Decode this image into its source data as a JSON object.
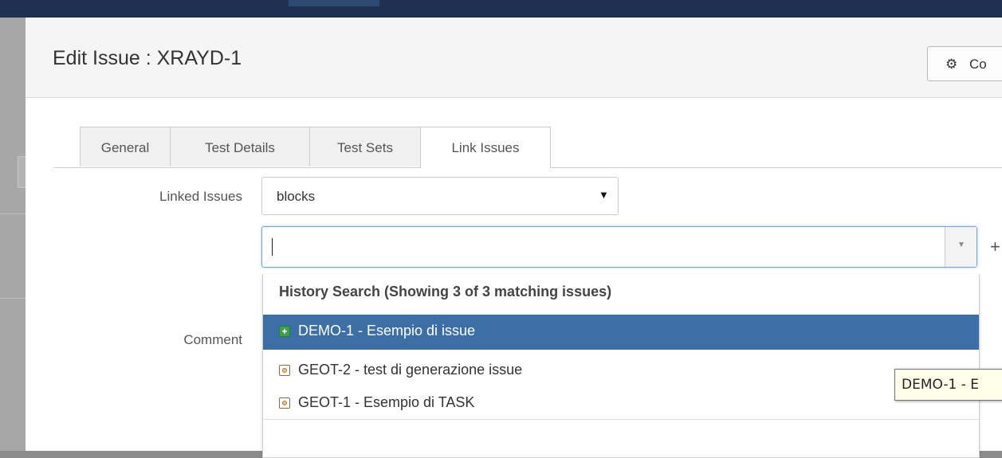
{
  "dialog": {
    "title": "Edit Issue : XRAYD-1",
    "configure_label": "Co",
    "gear_glyph": "⚙"
  },
  "tabs": [
    {
      "label": "General"
    },
    {
      "label": "Test Details"
    },
    {
      "label": "Test Sets"
    },
    {
      "label": "Link Issues",
      "active": true
    }
  ],
  "form": {
    "linked_issues_label": "Linked Issues",
    "link_type_value": "blocks",
    "select_arrow": "▼",
    "comment_label": "Comment",
    "search_value": "",
    "toggle_glyph": "▼",
    "add_glyph": "+"
  },
  "dropdown": {
    "heading": "History Search (Showing 3 of 3 matching issues)",
    "items": [
      {
        "label": "DEMO-1 - Esempio di issue",
        "icon": "new-feature-icon",
        "selected": true
      },
      {
        "label": "GEOT-2 - test di generazione issue",
        "icon": "task-icon",
        "selected": false
      },
      {
        "label": "GEOT-1 - Esempio di TASK",
        "icon": "task-icon",
        "selected": false
      }
    ]
  },
  "tooltip": {
    "text": "DEMO-1 - E"
  },
  "colors": {
    "selected_row": "#3d6fa7",
    "topbar": "#1f3150",
    "input_focus_border": "#6fa6d9"
  }
}
